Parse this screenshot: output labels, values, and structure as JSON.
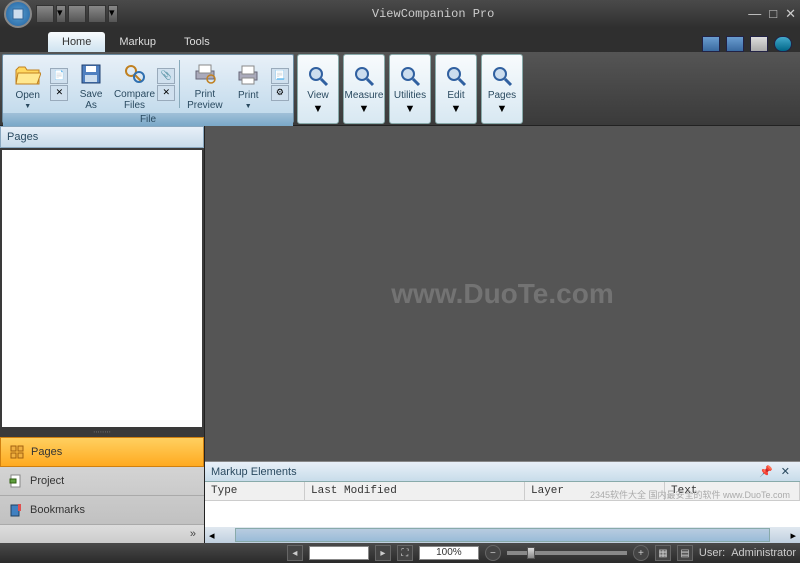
{
  "app": {
    "title": "ViewCompanion Pro"
  },
  "tabs": {
    "home": "Home",
    "markup": "Markup",
    "tools": "Tools"
  },
  "ribbon": {
    "file_group": "File",
    "open": "Open",
    "save_as": "Save\nAs",
    "compare": "Compare\nFiles",
    "print_preview": "Print\nPreview",
    "print": "Print",
    "view": "View",
    "measure": "Measure",
    "utilities": "Utilities",
    "edit": "Edit",
    "pages_btn": "Pages"
  },
  "sidebar": {
    "panel_title": "Pages",
    "nav": {
      "pages": "Pages",
      "project": "Project",
      "bookmarks": "Bookmarks"
    }
  },
  "markup_panel": {
    "title": "Markup Elements",
    "cols": {
      "type": "Type",
      "last_modified": "Last Modified",
      "layer": "Layer",
      "text": "Text"
    }
  },
  "status": {
    "zoom": "100%",
    "user_label": "User:",
    "user": "Administrator"
  },
  "watermark": "www.DuoTe.com",
  "badge": "2345软件大全 国内最安全的软件 www.DuoTe.com"
}
